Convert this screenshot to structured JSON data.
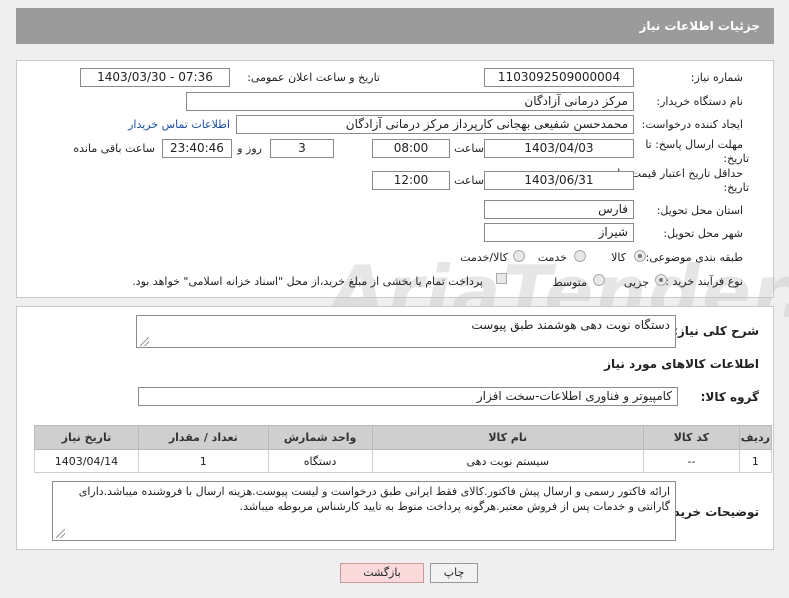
{
  "header": {
    "title": "جزئیات اطلاعات نیاز"
  },
  "labels": {
    "need_number": "شماره نیاز:",
    "announce_datetime": "تاریخ و ساعت اعلان عمومی:",
    "buyer_org": "نام دستگاه خریدار:",
    "requester": "ایجاد کننده درخواست:",
    "contact_link": "اطلاعات تماس خریدار",
    "reply_deadline": "مهلت ارسال پاسخ: تا",
    "reply_deadline_2": "تاریخ:",
    "time": "ساعت",
    "days": "روز و",
    "remaining": "ساعت باقی مانده",
    "price_validity": "حداقل تاریخ اعتبار قیمت: تا",
    "price_validity_2": "تاریخ:",
    "province": "استان محل تحویل:",
    "city": "شهر محل تحویل:",
    "category": "طبقه بندی موضوعی:",
    "process": "نوع فرآیند خرید :",
    "description": "شرح کلی نیاز:",
    "goods_info": "اطلاعات کالاهای مورد نیاز",
    "goods_group": "گروه کالا:",
    "buyer_notes": "توضیحات خریدار:"
  },
  "fields": {
    "need_number": "1103092509000004",
    "announce_datetime": "1403/03/30 - 07:36",
    "buyer_org": "مرکز درمانی آزادگان",
    "requester": "محمدحسن شفیعی بهجانی کارپرداز مرکز درمانی آزادگان",
    "reply_date": "1403/04/03",
    "reply_time": "08:00",
    "reply_days": "3",
    "reply_remaining": "23:40:46",
    "validity_date": "1403/06/31",
    "validity_time": "12:00",
    "province": "فارس",
    "city": "شیراز",
    "description": "دستگاه نوبت دهی هوشمند طبق پیوست",
    "goods_group": "کامپیوتر و فناوری اطلاعات-سخت افزار",
    "buyer_notes": "ارائه فاکتور رسمی و ارسال پیش فاکتور.کالای فقط ایرانی طبق درخواست و لیست پیوست.هزینه ارسال با فروشنده میباشد.دارای گارانتی و خدمات پس از فروش معتبر.هرگونه پرداخت منوط به تایید کارشناس مربوطه میباشد."
  },
  "category_options": {
    "goods": "کالا",
    "service": "خدمت",
    "goods_service": "کالا/خدمت",
    "selected": "کالا"
  },
  "process_options": {
    "small": "جزیی",
    "medium": "متوسط",
    "treasury_note": "پرداخت تمام یا بخشی از مبلغ خرید،از محل \"اسناد خزانه اسلامی\" خواهد بود.",
    "selected": "جزیی"
  },
  "table": {
    "headers": [
      "ردیف",
      "کد کالا",
      "نام کالا",
      "واحد شمارش",
      "تعداد / مقدار",
      "تاریخ نیاز"
    ],
    "rows": [
      [
        "1",
        "--",
        "سیستم نوبت دهی",
        "دستگاه",
        "1",
        "1403/04/14"
      ]
    ]
  },
  "buttons": {
    "print": "چاپ",
    "back": "بازگشت"
  },
  "watermark": "AriaTender.neT"
}
